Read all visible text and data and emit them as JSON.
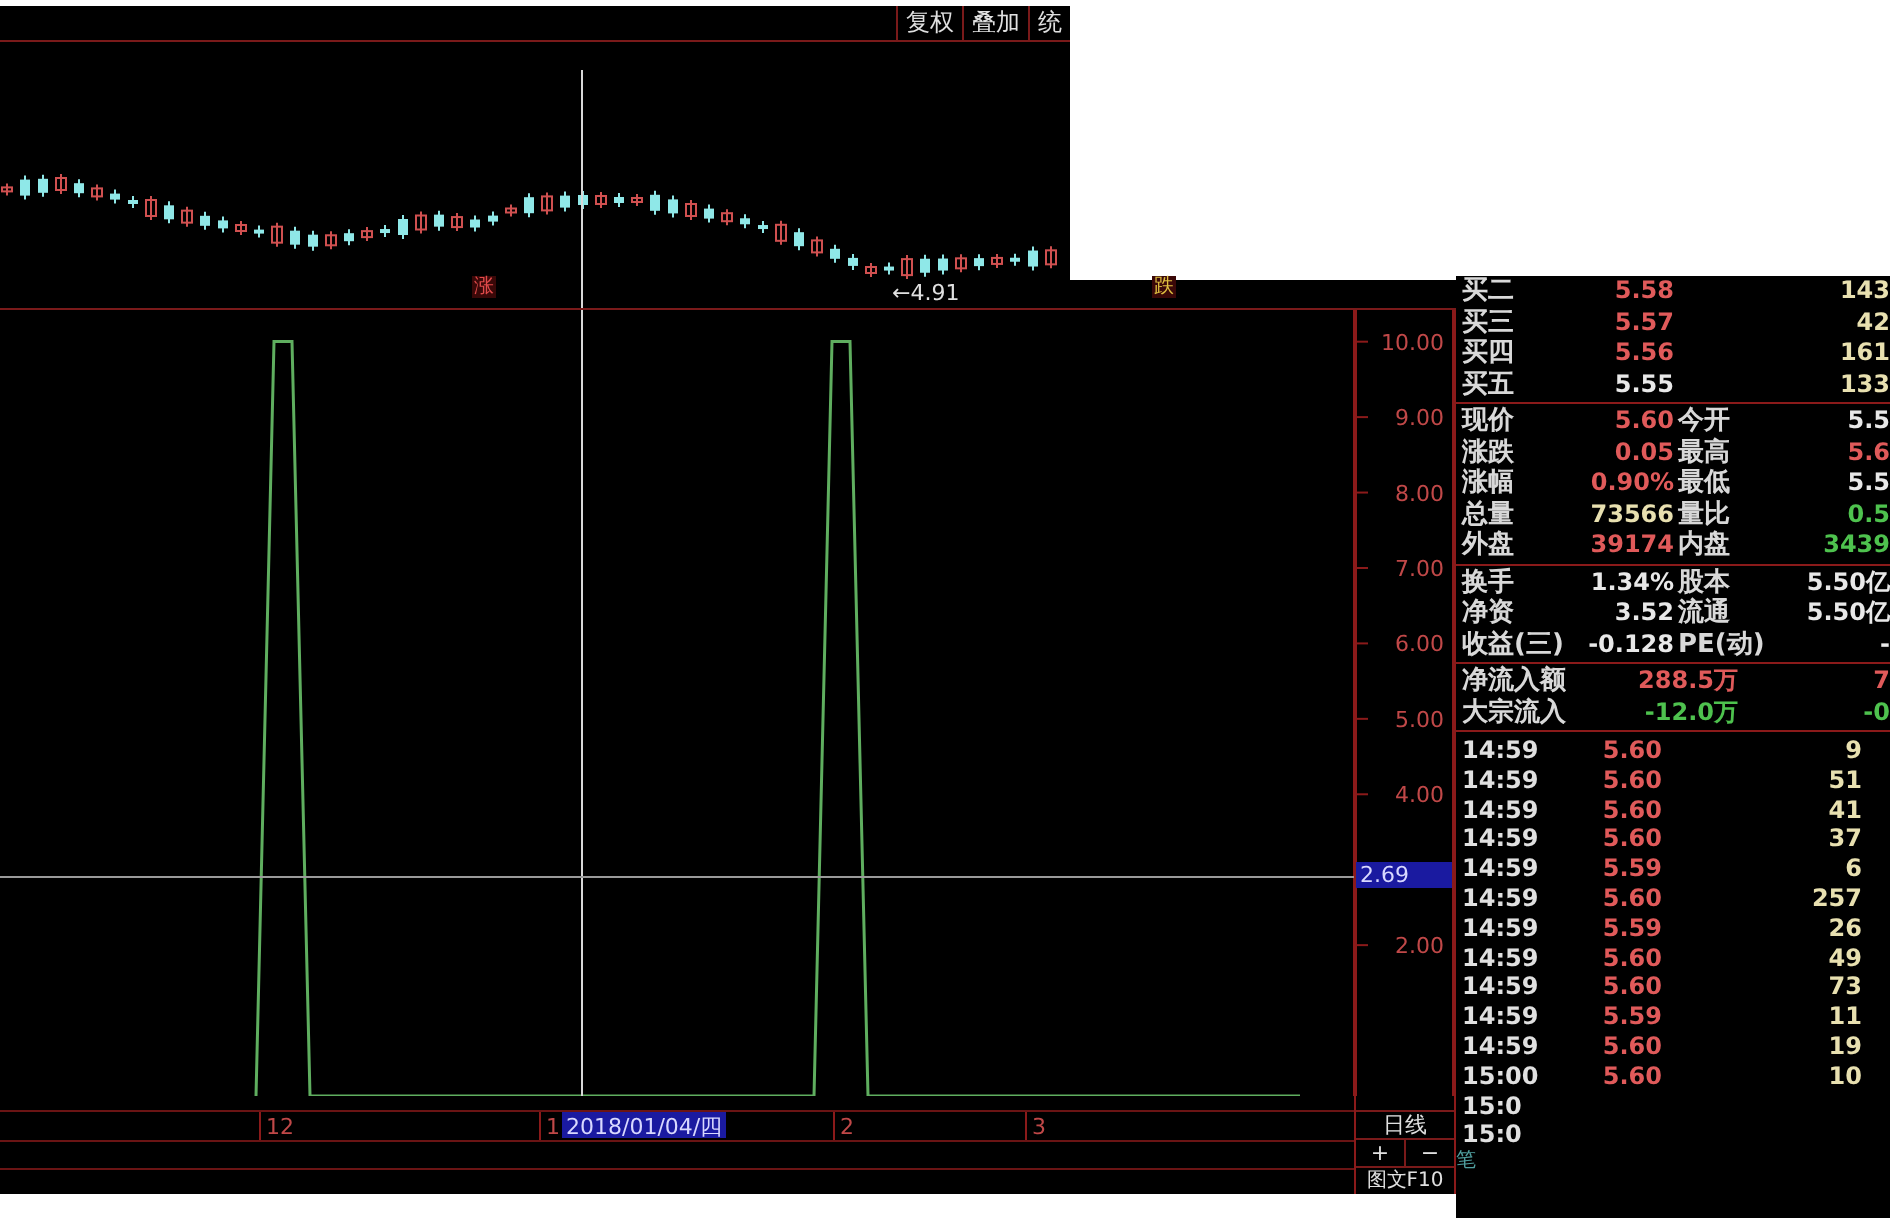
{
  "toolbar": {
    "buttons": [
      {
        "label": "复权"
      },
      {
        "label": "叠加"
      },
      {
        "label": "统"
      }
    ]
  },
  "price_chart": {
    "markers": [
      {
        "kind": "rise",
        "text": "涨"
      },
      {
        "kind": "fall",
        "text": "跌"
      }
    ],
    "low_label": "←4.91"
  },
  "crosshair": {
    "value_label": "2.69",
    "date_label": "2018/01/04/四"
  },
  "indicator_chart": {
    "chart_data": {
      "type": "line",
      "series": [
        {
          "color": "#5fae5f",
          "values": [
            null,
            null,
            null,
            null,
            null,
            null,
            null,
            null,
            null,
            null,
            null,
            null,
            null,
            null,
            0,
            10,
            10,
            0,
            0,
            0,
            0,
            0,
            0,
            0,
            0,
            0,
            0,
            0,
            0,
            0,
            0,
            0,
            0,
            0,
            0,
            0,
            0,
            0,
            0,
            0,
            0,
            0,
            0,
            0,
            0,
            0,
            10,
            10,
            0,
            0,
            0,
            0,
            0,
            0,
            0,
            0,
            0,
            0,
            0,
            0,
            0,
            0,
            0,
            0,
            0,
            0,
            0,
            0,
            0,
            0,
            0,
            0,
            0
          ]
        }
      ],
      "ylim": [
        0,
        10.42
      ],
      "yticks": [
        {
          "value": 10,
          "label": "10.00"
        },
        {
          "value": 9,
          "label": "9.00"
        },
        {
          "value": 8,
          "label": "8.00"
        },
        {
          "value": 7,
          "label": "7.00"
        },
        {
          "value": 6,
          "label": "6.00"
        },
        {
          "value": 5,
          "label": "5.00"
        },
        {
          "value": 4,
          "label": "4.00"
        },
        {
          "value": 2,
          "label": "2.00"
        }
      ]
    }
  },
  "x_axis": {
    "labels": [
      "12",
      "1",
      "2",
      "3"
    ]
  },
  "period_panel": {
    "period": "日线",
    "zoom_in": "+",
    "zoom_out": "−",
    "f10_tab": "图文F10",
    "ticks_tab": "笔"
  },
  "quote": {
    "bids": [
      {
        "label": "买二",
        "price": "5.58",
        "color": "#e05a5a",
        "volume": "143"
      },
      {
        "label": "买三",
        "price": "5.57",
        "color": "#e05a5a",
        "volume": "42"
      },
      {
        "label": "买四",
        "price": "5.56",
        "color": "#e05a5a",
        "volume": "161"
      },
      {
        "label": "买五",
        "price": "5.55",
        "color": "#e8e8e8",
        "volume": "133"
      }
    ],
    "stats": [
      {
        "cells": [
          {
            "label": "现价",
            "value": "5.60",
            "color": "#e05a5a"
          },
          {
            "label": "今开",
            "value": "5.5",
            "color": "#e8e8e8"
          }
        ]
      },
      {
        "cells": [
          {
            "label": "涨跌",
            "value": "0.05",
            "color": "#e05a5a"
          },
          {
            "label": "最高",
            "value": "5.6",
            "color": "#e05a5a"
          }
        ]
      },
      {
        "cells": [
          {
            "label": "涨幅",
            "value": "0.90%",
            "color": "#e05a5a"
          },
          {
            "label": "最低",
            "value": "5.5",
            "color": "#e8e8e8"
          }
        ]
      },
      {
        "cells": [
          {
            "label": "总量",
            "value": "73566",
            "color": "#e8e0b0"
          },
          {
            "label": "量比",
            "value": "0.5",
            "color": "#4ec24e"
          }
        ]
      },
      {
        "cells": [
          {
            "label": "外盘",
            "value": "39174",
            "color": "#e05a5a"
          },
          {
            "label": "内盘",
            "value": "3439",
            "color": "#4ec24e"
          }
        ]
      }
    ],
    "capital": [
      {
        "cells": [
          {
            "label": "换手",
            "value": "1.34%",
            "color": "#e8e8e8"
          },
          {
            "label": "股本",
            "value": "5.50亿",
            "color": "#e8e8e8"
          }
        ]
      },
      {
        "cells": [
          {
            "label": "净资",
            "value": "3.52",
            "color": "#e8e8e8"
          },
          {
            "label": "流通",
            "value": "5.50亿",
            "color": "#e8e8e8"
          }
        ]
      },
      {
        "cells": [
          {
            "label": "收益(三)",
            "value": "-0.128",
            "color": "#e8e8e8"
          },
          {
            "label": "PE(动)",
            "value": "-",
            "color": "#e8e8e8"
          }
        ]
      }
    ],
    "flows": [
      {
        "label": "净流入额",
        "values": [
          {
            "value": "288.5万",
            "color": "#e05a5a"
          },
          {
            "value": "7",
            "color": "#e05a5a"
          }
        ]
      },
      {
        "label": "大宗流入",
        "values": [
          {
            "value": "-12.0万",
            "color": "#4ec24e"
          },
          {
            "value": "-0",
            "color": "#4ec24e"
          }
        ]
      }
    ],
    "ticks": [
      {
        "time": "14:59",
        "price": "5.60",
        "color": "#e05a5a",
        "volume": "9"
      },
      {
        "time": "14:59",
        "price": "5.60",
        "color": "#e05a5a",
        "volume": "51"
      },
      {
        "time": "14:59",
        "price": "5.60",
        "color": "#e05a5a",
        "volume": "41"
      },
      {
        "time": "14:59",
        "price": "5.60",
        "color": "#e05a5a",
        "volume": "37"
      },
      {
        "time": "14:59",
        "price": "5.59",
        "color": "#e05a5a",
        "volume": "6"
      },
      {
        "time": "14:59",
        "price": "5.60",
        "color": "#e05a5a",
        "volume": "257"
      },
      {
        "time": "14:59",
        "price": "5.59",
        "color": "#e05a5a",
        "volume": "26"
      },
      {
        "time": "14:59",
        "price": "5.60",
        "color": "#e05a5a",
        "volume": "49"
      },
      {
        "time": "14:59",
        "price": "5.60",
        "color": "#e05a5a",
        "volume": "73"
      },
      {
        "time": "14:59",
        "price": "5.59",
        "color": "#e05a5a",
        "volume": "11"
      },
      {
        "time": "14:59",
        "price": "5.60",
        "color": "#e05a5a",
        "volume": "19"
      },
      {
        "time": "15:00",
        "price": "5.60",
        "color": "#e05a5a",
        "volume": "10"
      },
      {
        "time": "15:0"
      },
      {
        "time": "15:0"
      }
    ]
  }
}
